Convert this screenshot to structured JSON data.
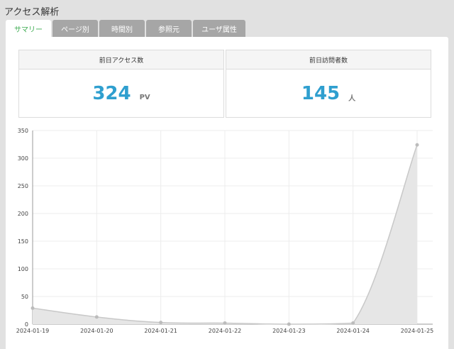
{
  "page_title": "アクセス解析",
  "tabs": [
    {
      "label": "サマリー",
      "active": true
    },
    {
      "label": "ページ別",
      "active": false
    },
    {
      "label": "時間別",
      "active": false
    },
    {
      "label": "参照元",
      "active": false
    },
    {
      "label": "ユーザ属性",
      "active": false
    }
  ],
  "stats": {
    "access": {
      "label": "前日アクセス数",
      "value": "324",
      "unit": "PV"
    },
    "visitors": {
      "label": "前日訪問者数",
      "value": "145",
      "unit": "人"
    }
  },
  "colors": {
    "accent": "#2f9fcf",
    "active_tab": "#3bab4f",
    "tab_bg": "#a6a6a6"
  },
  "chart_data": {
    "type": "area",
    "x": [
      "2024-01-19",
      "2024-01-20",
      "2024-01-21",
      "2024-01-22",
      "2024-01-23",
      "2024-01-24",
      "2024-01-25"
    ],
    "series": [
      {
        "values": [
          29,
          13,
          3,
          2,
          0,
          2,
          324
        ]
      }
    ],
    "ylim": [
      0,
      350
    ],
    "yticks": [
      0,
      50,
      100,
      150,
      200,
      250,
      300,
      350
    ],
    "grid": true
  }
}
